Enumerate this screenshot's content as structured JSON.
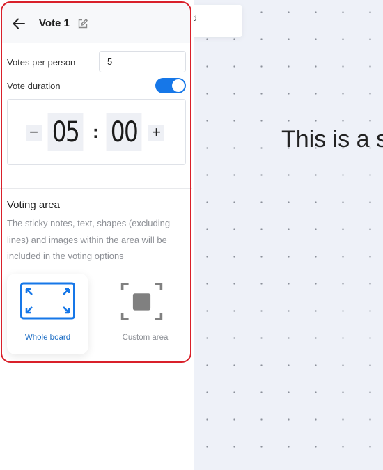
{
  "panel": {
    "title": "Vote 1",
    "icons": {
      "back": "arrow-left-icon",
      "edit": "edit-pencil-icon"
    },
    "votes_per_person": {
      "label": "Votes per person",
      "value": "5"
    },
    "vote_duration": {
      "label": "Vote duration",
      "enabled": true
    },
    "timer": {
      "minutes": "05",
      "separator": ":",
      "seconds": "00",
      "decrement": "−",
      "increment": "+"
    },
    "voting_area": {
      "title": "Voting area",
      "description": "The sticky notes, text, shapes (excluding lines) and images within the area will be included in the voting options",
      "options": [
        {
          "label": "Whole board",
          "icon": "expand-arrows-icon",
          "selected": true
        },
        {
          "label": "Custom area",
          "icon": "select-region-icon",
          "selected": false
        }
      ]
    }
  },
  "canvas": {
    "card_text": "d",
    "text": "This is a s"
  },
  "colors": {
    "accent": "#1677e8",
    "highlight": "#d9202a",
    "canvas_bg": "#eef1f8"
  }
}
